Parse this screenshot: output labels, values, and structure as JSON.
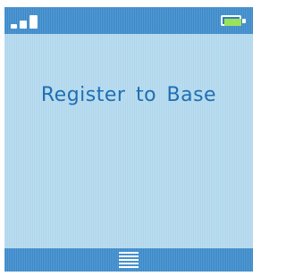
{
  "status_bar": {
    "signal_icon": "signal-strength-icon",
    "signal_level": 3,
    "battery_icon": "battery-icon",
    "battery_level": 1.0,
    "battery_fill_color": "#9be25a"
  },
  "main": {
    "message": "Register to Base"
  },
  "softkey": {
    "menu_icon": "menu-icon"
  },
  "colors": {
    "screen_background": "#b3d9ee",
    "bar_background": "#3f8fd0",
    "text": "#1f6fb2"
  }
}
